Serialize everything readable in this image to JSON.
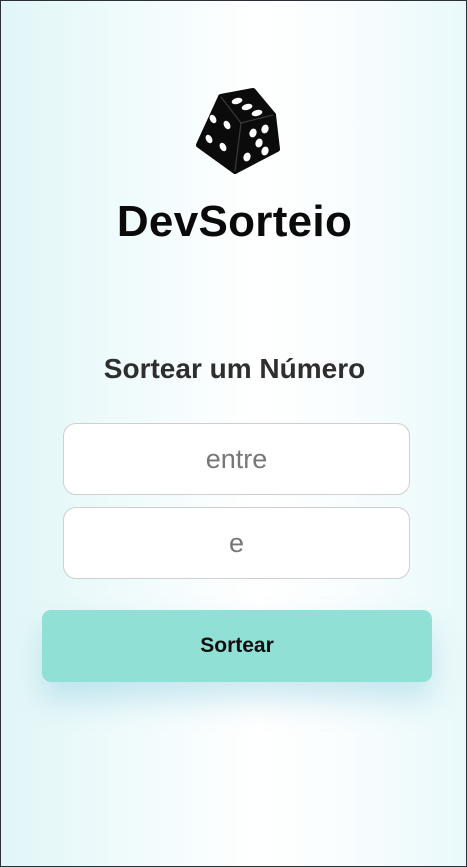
{
  "app": {
    "brand_name": "DevSorteio",
    "logo_icon": "dice-icon"
  },
  "draw": {
    "title": "Sortear um Número",
    "min_field": {
      "value": "",
      "placeholder": "entre"
    },
    "max_field": {
      "value": "",
      "placeholder": "e"
    },
    "submit_label": "Sortear"
  },
  "colors": {
    "button_background": "#90e0d6",
    "brand_text": "#0a0a0a",
    "title_text": "#2e2e2e"
  }
}
